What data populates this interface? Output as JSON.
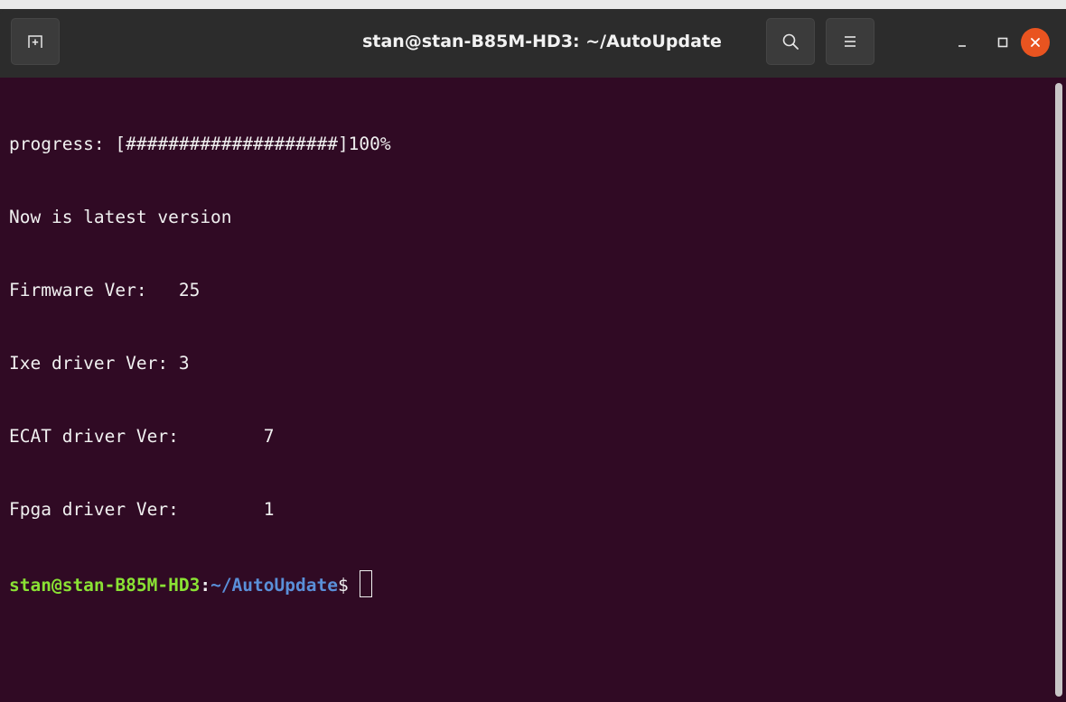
{
  "window": {
    "title": "stan@stan-B85M-HD3: ~/AutoUpdate"
  },
  "icons": {
    "new_tab": "new-tab-icon",
    "search": "search-icon",
    "menu": "hamburger-menu-icon",
    "minimize": "minimize-icon",
    "maximize": "maximize-icon",
    "close": "close-icon"
  },
  "colors": {
    "terminal_bg": "#300a24",
    "titlebar_bg": "#2c2c2c",
    "close_button": "#e95420",
    "prompt_user": "#8ae234",
    "prompt_path": "#5a8fd8",
    "text": "#f0f0f0"
  },
  "terminal": {
    "lines": [
      "progress: [####################]100%",
      "Now is latest version",
      "Firmware Ver:   25",
      "Ixe driver Ver: 3",
      "ECAT driver Ver:        7",
      "Fpga driver Ver:        1"
    ],
    "prompt": {
      "user_host": "stan@stan-B85M-HD3",
      "colon": ":",
      "path": "~/AutoUpdate",
      "symbol": "$"
    }
  }
}
